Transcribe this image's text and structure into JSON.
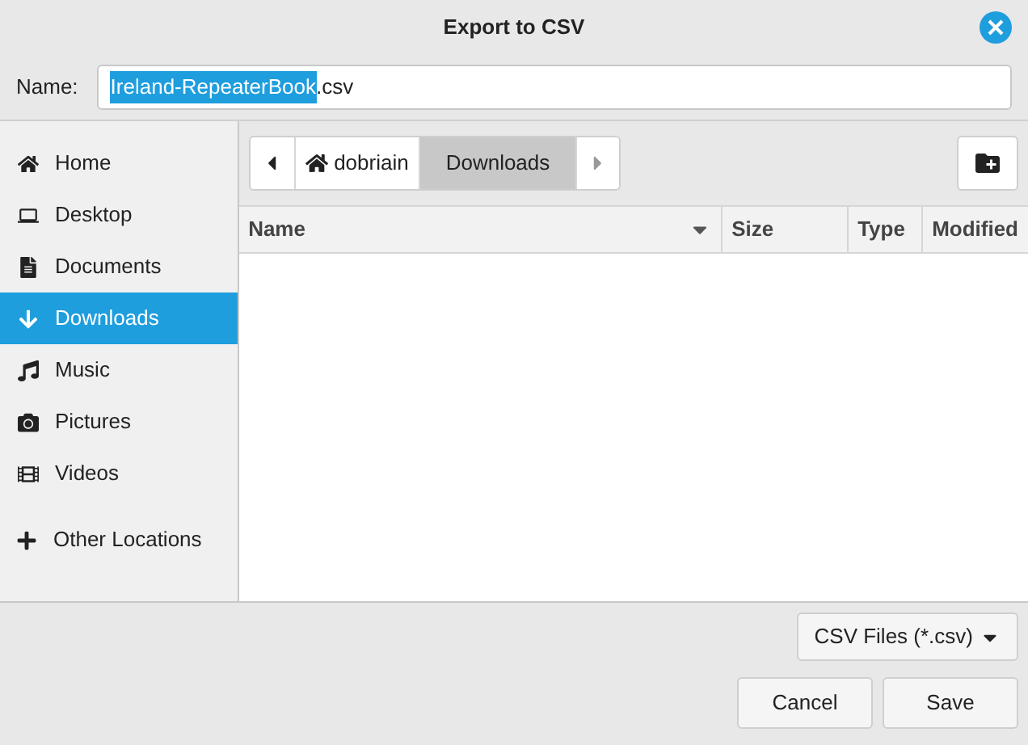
{
  "window": {
    "title": "Export to CSV"
  },
  "name_field": {
    "label": "Name:",
    "selected_text": "Ireland-RepeaterBook",
    "rest_text": ".csv"
  },
  "sidebar": {
    "items": [
      {
        "label": "Home",
        "selected": false
      },
      {
        "label": "Desktop",
        "selected": false
      },
      {
        "label": "Documents",
        "selected": false
      },
      {
        "label": "Downloads",
        "selected": true
      },
      {
        "label": "Music",
        "selected": false
      },
      {
        "label": "Pictures",
        "selected": false
      },
      {
        "label": "Videos",
        "selected": false
      }
    ],
    "other_locations": "Other Locations"
  },
  "path_bar": [
    {
      "label": "dobriain",
      "selected": false,
      "kind": "home"
    },
    {
      "label": "Downloads",
      "selected": true,
      "kind": "folder"
    }
  ],
  "table": {
    "columns": [
      "Name",
      "Size",
      "Type",
      "Modified"
    ]
  },
  "filter": "CSV Files (*.csv)",
  "buttons": [
    "Cancel",
    "Save"
  ]
}
